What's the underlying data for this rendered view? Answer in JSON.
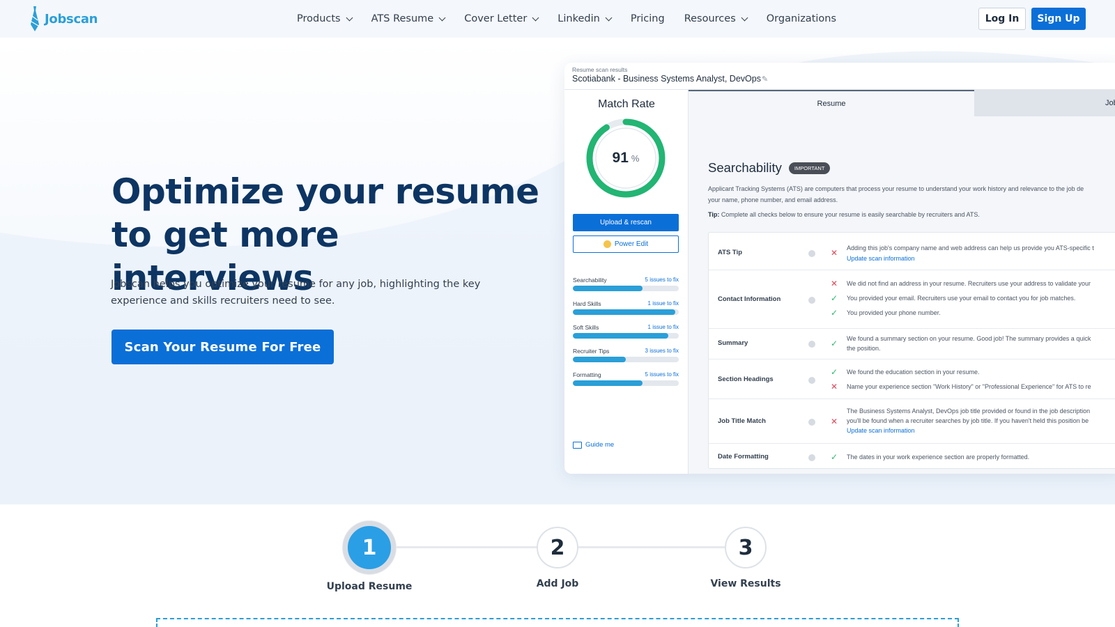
{
  "nav": {
    "logo_text": "Jobscan",
    "menu": [
      {
        "label": "Products",
        "dropdown": true
      },
      {
        "label": "ATS Resume",
        "dropdown": true
      },
      {
        "label": "Cover Letter",
        "dropdown": true
      },
      {
        "label": "Linkedin",
        "dropdown": true
      },
      {
        "label": "Pricing",
        "dropdown": false
      },
      {
        "label": "Resources",
        "dropdown": true
      },
      {
        "label": "Organizations",
        "dropdown": false
      }
    ],
    "login_label": "Log In",
    "signup_label": "Sign Up"
  },
  "hero": {
    "headline": "Optimize your resume to get more interviews",
    "subtext": "Jobscan helps you optimize your resume for any job, highlighting the key experience and skills recruiters need to see.",
    "cta_label": "Scan Your Resume For Free"
  },
  "preview": {
    "small_label": "Resume scan results",
    "title": "Scotiabank - Business Systems Analyst, DevOps",
    "match_rate_title": "Match Rate",
    "match_rate_value": "91",
    "match_rate_unit": "%",
    "match_rate_fraction": 0.91,
    "upload_label": "Upload & rescan",
    "power_edit_label": "Power Edit",
    "categories": [
      {
        "name": "Searchability",
        "issues": "5 issues to fix",
        "progress": 0.66
      },
      {
        "name": "Hard Skills",
        "issues": "1 issue to fix",
        "progress": 0.97
      },
      {
        "name": "Soft Skills",
        "issues": "1 issue to fix",
        "progress": 0.9
      },
      {
        "name": "Recruiter Tips",
        "issues": "3 issues to fix",
        "progress": 0.5
      },
      {
        "name": "Formatting",
        "issues": "5 issues to fix",
        "progress": 0.66
      }
    ],
    "guide_label": "Guide me",
    "tab_resume": "Resume",
    "tab_job": "Job",
    "section_title": "Searchability",
    "important_badge": "IMPORTANT",
    "description_1": "Applicant Tracking Systems (ATS) are computers that process your resume to understand your work history and relevance to the job de",
    "description_2": "your name, phone number, and email address.",
    "tip_label": "Tip:",
    "tip_text": "Complete all checks below to ensure your resume is easily searchable by recruiters and ATS.",
    "rows": [
      {
        "label": "ATS Tip",
        "lines": [
          {
            "status": "x",
            "text": "Adding this job's company name and web address can help us provide you ATS-specific t"
          },
          {
            "status": "none",
            "link": "Update scan information"
          }
        ]
      },
      {
        "label": "Contact Information",
        "lines": [
          {
            "status": "x",
            "text": "We did not find an address in your resume. Recruiters use your address to validate your"
          },
          {
            "status": "ok",
            "text": "You provided your email. Recruiters use your email to contact you for job matches."
          },
          {
            "status": "ok",
            "text": "You provided your phone number."
          }
        ]
      },
      {
        "label": "Summary",
        "lines": [
          {
            "status": "ok",
            "text": "We found a summary section on your resume. Good job! The summary provides a quick"
          },
          {
            "status": "none",
            "text": "the position."
          }
        ]
      },
      {
        "label": "Section Headings",
        "lines": [
          {
            "status": "ok",
            "text": "We found the education section in your resume."
          },
          {
            "status": "x",
            "text": "Name your experience section \"Work History\" or \"Professional Experience\" for ATS to re"
          }
        ]
      },
      {
        "label": "Job Title Match",
        "lines": [
          {
            "status": "none",
            "text": "The Business Systems Analyst, DevOps job title provided or found in the job description"
          },
          {
            "status": "x",
            "text": "you'll be found when a recruiter searches by job title. If you haven't held this position be"
          },
          {
            "status": "none",
            "link": "Update scan information"
          }
        ]
      },
      {
        "label": "Date Formatting",
        "lines": [
          {
            "status": "ok",
            "text": "The dates in your work experience section are properly formatted."
          }
        ]
      }
    ]
  },
  "steps": [
    {
      "number": "1",
      "label": "Upload Resume",
      "active": true
    },
    {
      "number": "2",
      "label": "Add Job",
      "active": false
    },
    {
      "number": "3",
      "label": "View Results",
      "active": false
    }
  ],
  "colors": {
    "brand": "#0b6fd8",
    "accent": "#2a9fd8",
    "headline": "#0d3563",
    "success": "#2eb872",
    "error": "#e04a5a"
  }
}
